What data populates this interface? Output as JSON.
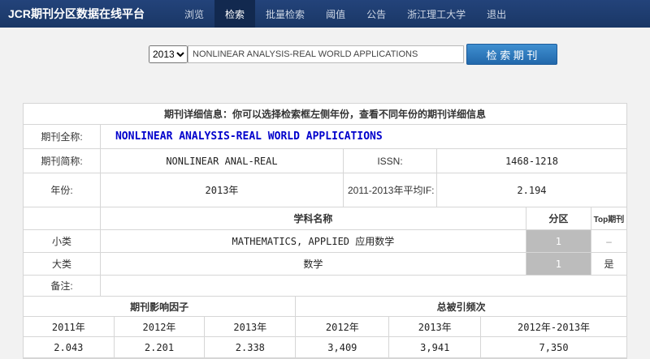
{
  "colors": {
    "navbar_bg": "#1d3c6f",
    "navbar_active_bg": "#12294f",
    "search_button_bg": "#2e7cc0",
    "journal_name_blue": "#0000cc",
    "partition_cell_gray": "#bcbcbc"
  },
  "navbar": {
    "title": "JCR期刊分区数据在线平台",
    "items": [
      {
        "label": "浏览"
      },
      {
        "label": "检索"
      },
      {
        "label": "批量检索"
      },
      {
        "label": "阈值"
      },
      {
        "label": "公告"
      },
      {
        "label": "浙江理工大学"
      },
      {
        "label": "退出"
      }
    ]
  },
  "search": {
    "year": "2013",
    "query": "NONLINEAR ANALYSIS-REAL WORLD APPLICATIONS",
    "button_label": "检 索 期 刊"
  },
  "panel": {
    "header": "期刊详细信息：你可以选择检索框左侧年份，查看不同年份的期刊详细信息",
    "labels": {
      "full_name": "期刊全称:",
      "short_name": "期刊简称:",
      "issn": "ISSN:",
      "year": "年份:",
      "avg_if": "2011-2013年平均IF:",
      "subject": "学科名称",
      "partition": "分区",
      "top": "Top期刊",
      "remark": "备注:",
      "if_header": "期刊影响因子",
      "cites_header": "总被引频次"
    },
    "values": {
      "full_name": "NONLINEAR ANALYSIS-REAL WORLD APPLICATIONS",
      "short_name": "NONLINEAR ANAL-REAL",
      "issn": "1468-1218",
      "year": "2013年",
      "avg_if": "2.194",
      "remark": ""
    },
    "subject_rows": [
      {
        "type": "小类",
        "name": "MATHEMATICS, APPLIED 应用数学",
        "partition": "1",
        "top": "–"
      },
      {
        "type": "大类",
        "name": "数学",
        "partition": "1",
        "top": "是"
      }
    ],
    "metrics": {
      "col_headers": [
        "2011年",
        "2012年",
        "2013年",
        "2012年",
        "2013年",
        "2012年-2013年"
      ],
      "values": [
        "2.043",
        "2.201",
        "2.338",
        "3,409",
        "3,941",
        "7,350"
      ]
    }
  }
}
